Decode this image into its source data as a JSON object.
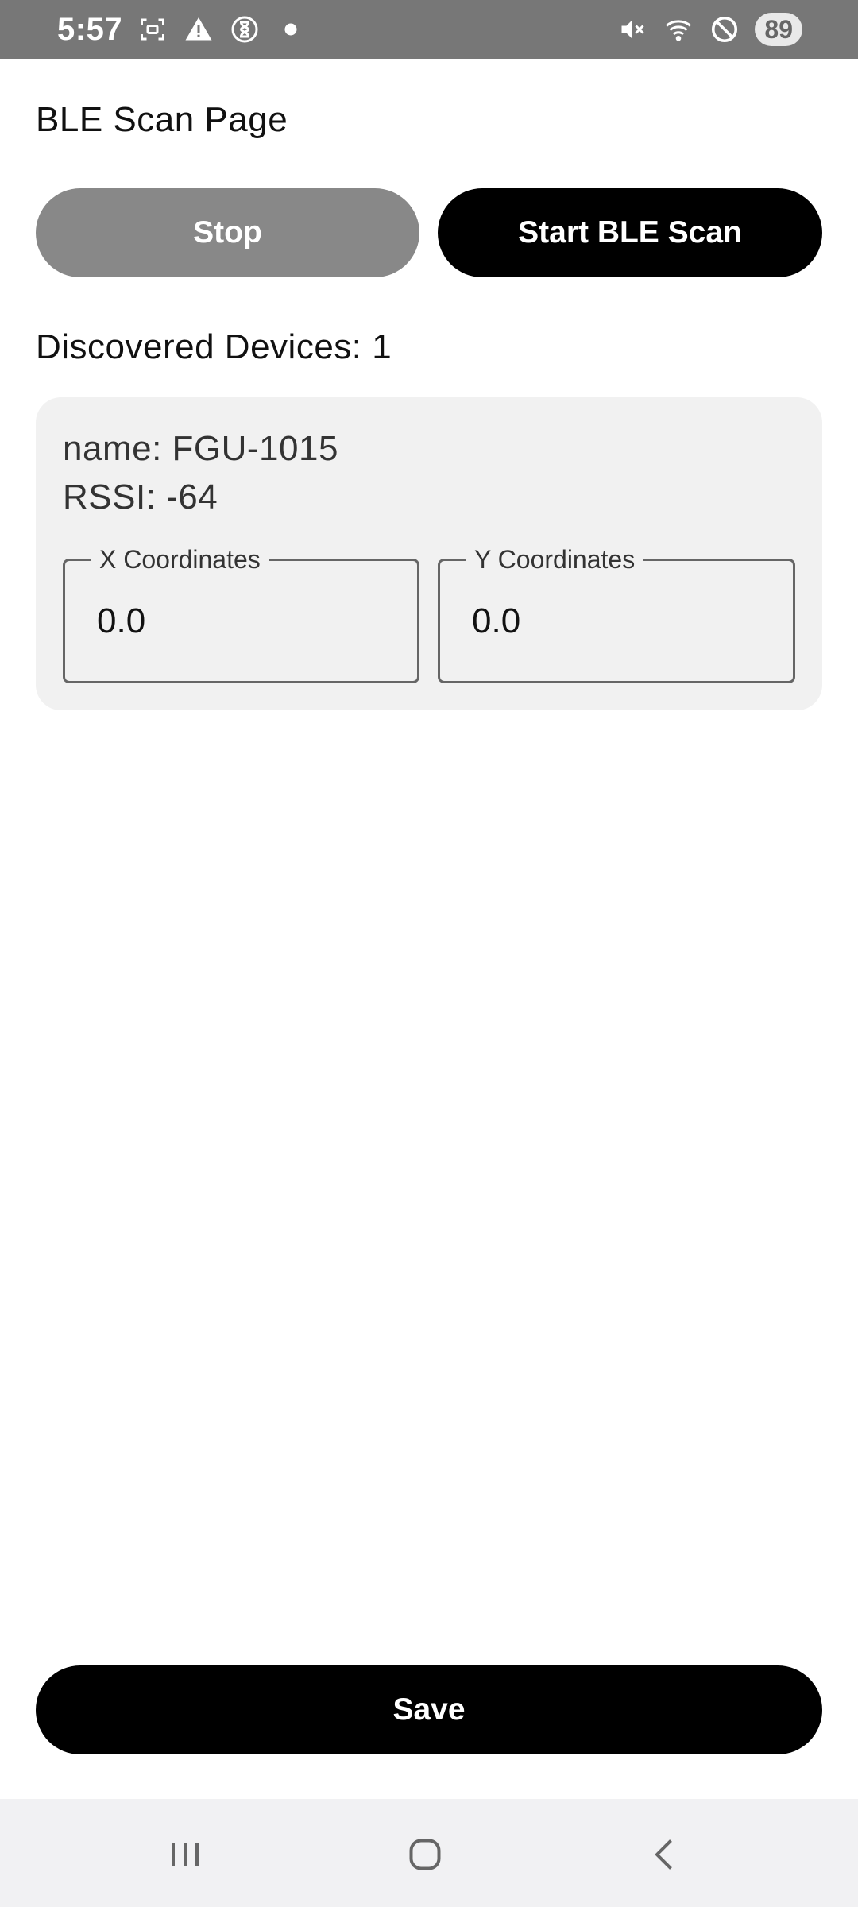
{
  "status_bar": {
    "time": "5:57",
    "battery": "89",
    "left_icons": [
      "screenshot-icon",
      "warning-icon",
      "hourglass-icon",
      "notification-dot-icon"
    ],
    "right_icons": [
      "mute-icon",
      "wifi-icon",
      "do-not-disturb-icon"
    ]
  },
  "page": {
    "title": "BLE Scan Page"
  },
  "buttons": {
    "stop_label": "Stop",
    "start_label": "Start BLE Scan",
    "save_label": "Save"
  },
  "discovered": {
    "text": "Discovered Devices: 1"
  },
  "devices": [
    {
      "name": "name: FGU-1015",
      "rssi": "RSSI: -64",
      "x_label": "X Coordinates",
      "x_value": "0.0",
      "y_label": "Y Coordinates",
      "y_value": "0.0"
    }
  ],
  "nav_bar": {
    "items": [
      "recents-icon",
      "home-icon",
      "back-icon"
    ]
  },
  "colors": {
    "status_bar": "#777777",
    "stop_button": "#888888",
    "primary_button": "#000000",
    "card_background": "#f1f1f1",
    "nav_bar": "#f1f1f3"
  }
}
